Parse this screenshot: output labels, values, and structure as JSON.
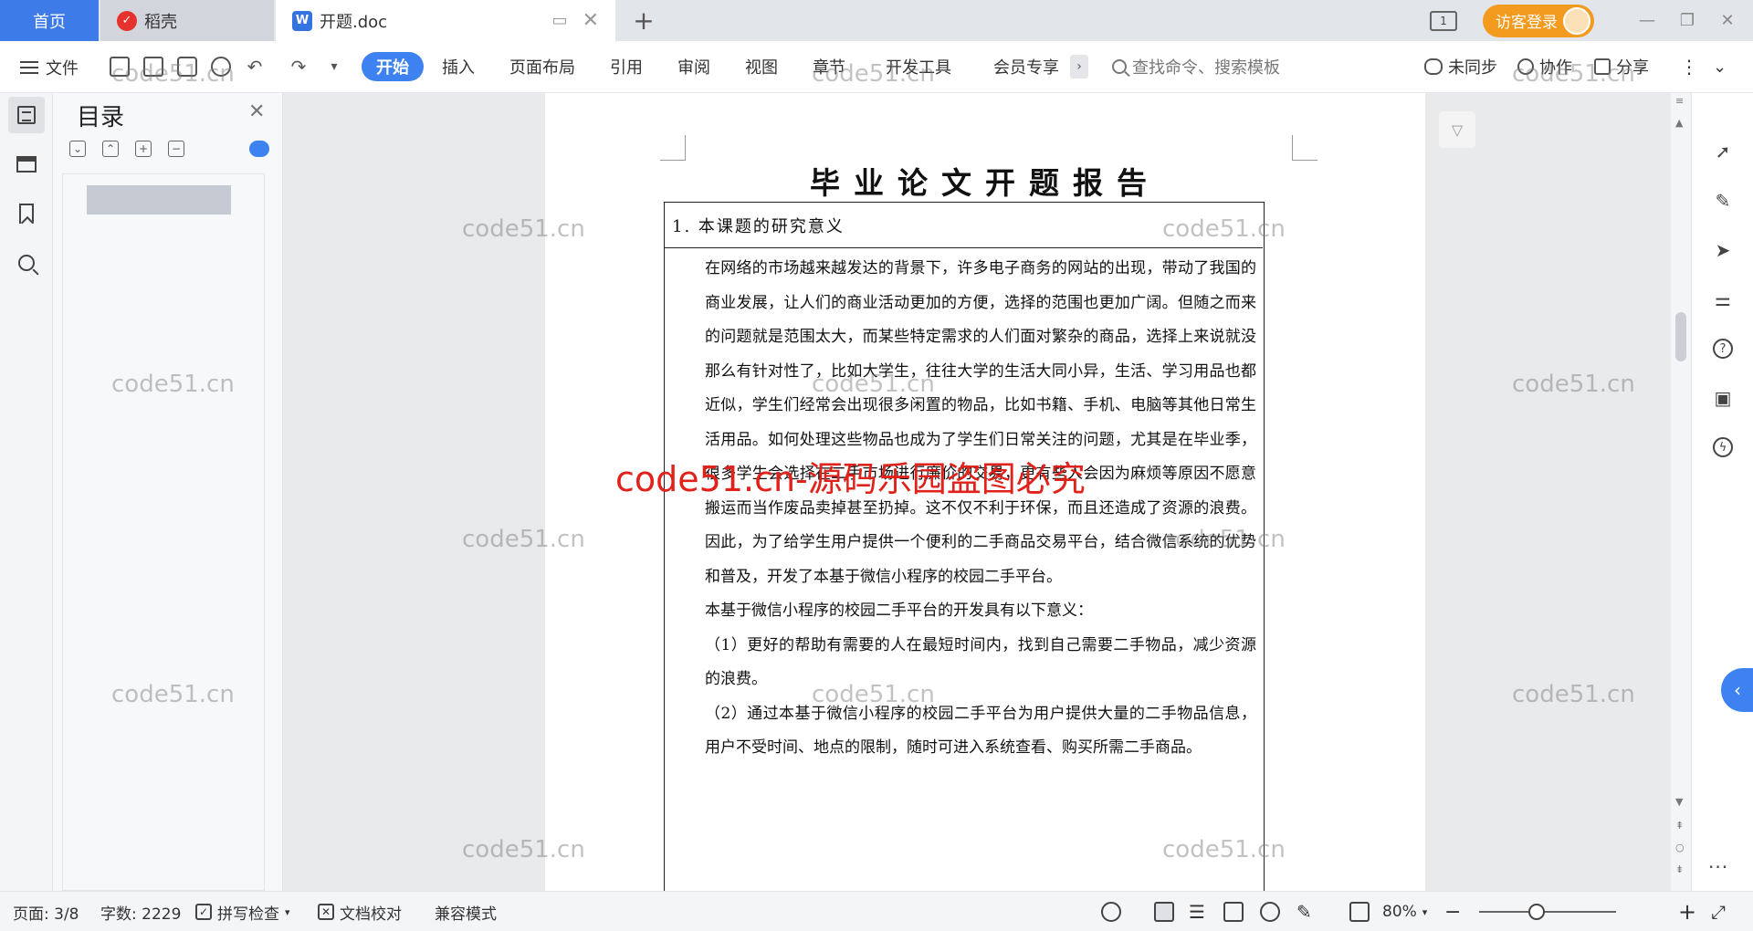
{
  "tabs": {
    "home": "首页",
    "daoke": "稻壳",
    "doc": "开题.doc",
    "layout_badge": "1",
    "visitor_login": "访客登录"
  },
  "ribbon": {
    "file": "文件",
    "tabs": [
      "开始",
      "插入",
      "页面布局",
      "引用",
      "审阅",
      "视图",
      "章节",
      "开发工具",
      "会员专享"
    ],
    "active_tab": "开始",
    "search_placeholder": "查找命令、搜索模板",
    "sync": "未同步",
    "collaborate": "协作",
    "share": "分享"
  },
  "toc": {
    "title": "目录"
  },
  "document": {
    "title": "毕业论文开题报告",
    "section": "1. 本课题的研究意义",
    "paragraphs": [
      "在网络的市场越来越发达的背景下，许多电子商务的网站的出现，带动了我国的商业发展，让人们的商业活动更加的方便，选择的范围也更加广阔。但随之而来的问题就是范围太大，而某些特定需求的人们面对繁杂的商品，选择上来说就没那么有针对性了，比如大学生，往往大学的生活大同小异，生活、学习用品也都近似，学生们经常会出现很多闲置的物品，比如书籍、手机、电脑等其他日常生活用品。如何处理这些物品也成为了学生们日常关注的问题，尤其是在毕业季，很多学生会选择在二手市场进行廉价的交易，更有些人会因为麻烦等原因不愿意搬运而当作废品卖掉甚至扔掉。这不仅不利于环保，而且还造成了资源的浪费。因此，为了给学生用户提供一个便利的二手商品交易平台，结合微信系统的优势和普及，开发了本基于微信小程序的校园二手平台。",
      "本基于微信小程序的校园二手平台的开发具有以下意义：",
      "（1）更好的帮助有需要的人在最短时间内，找到自己需要二手物品，减少资源的浪费。",
      "（2）通过本基于微信小程序的校园二手平台为用户提供大量的二手物品信息，用户不受时间、地点的限制，随时可进入系统查看、购买所需二手商品。"
    ]
  },
  "watermarks": {
    "grey": "code51.cn",
    "red": "code51.cn-源码乐园盗图必究"
  },
  "status": {
    "page": "页面: 3/8",
    "words": "字数: 2229",
    "spellcheck": "拼写检查",
    "proofread": "文档校对",
    "compat": "兼容模式",
    "zoom": "80%",
    "zoom_level": 0.8
  },
  "colors": {
    "accent": "#3d82f0",
    "home_tab": "#3d7be8",
    "visitor_button": "#f39b1f",
    "red_watermark": "#e0221a"
  }
}
